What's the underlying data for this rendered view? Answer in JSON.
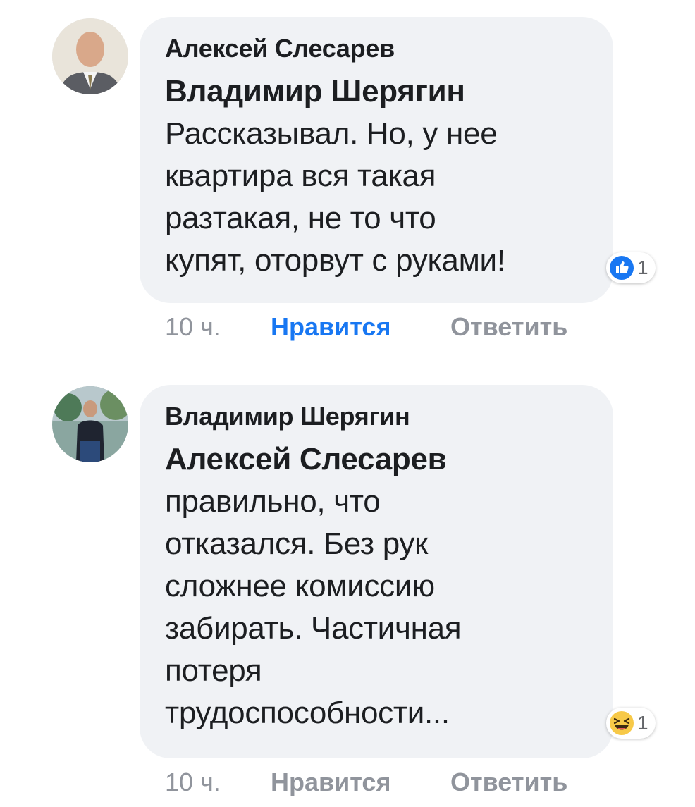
{
  "comments": [
    {
      "author": "Алексей Слесарев",
      "mention": "Владимир Шерягин",
      "lines": [
        "Рассказывал. Но, у нее",
        "квартира вся такая",
        "разтакая, не то что",
        "купят, оторвут с руками!"
      ],
      "reaction": {
        "icon": "like-reaction-icon",
        "count": "1"
      },
      "time": "10 ч.",
      "like_label": "Нравится",
      "reply_label": "Ответить",
      "like_active": true
    },
    {
      "author": "Владимир Шерягин",
      "mention": "Алексей Слесарев",
      "lines": [
        "правильно, что",
        "отказался. Без рук",
        "сложнее комиссию",
        "забирать. Частичная",
        "потеря",
        "трудоспособности..."
      ],
      "reaction": {
        "icon": "haha-reaction-icon",
        "count": "1"
      },
      "time": "10 ч.",
      "like_label": "Нравится",
      "reply_label": "Ответить",
      "like_active": false
    }
  ],
  "colors": {
    "bubble": "#f0f2f5",
    "text": "#1c1e21",
    "muted": "#90949c",
    "link": "#1877f2"
  }
}
